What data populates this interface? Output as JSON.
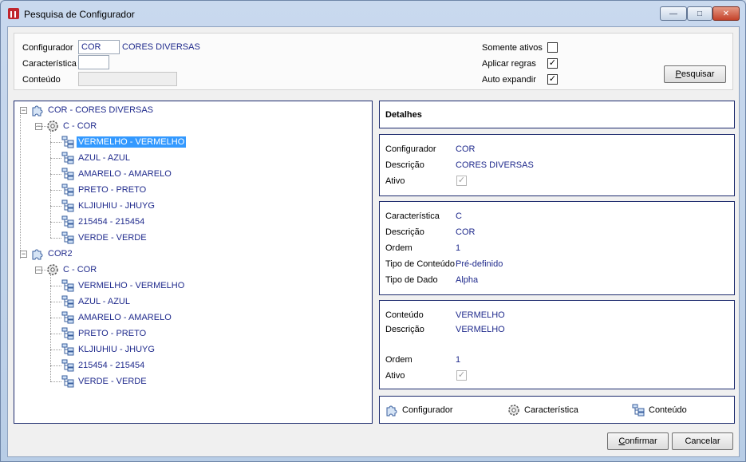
{
  "window": {
    "title": "Pesquisa de Configurador",
    "controls": {
      "minimize": "—",
      "maximize": "□",
      "close": "✕"
    }
  },
  "filters": {
    "configurador_label": "Configurador",
    "configurador_value": "COR",
    "configurador_desc": "CORES DIVERSAS",
    "caracteristica_label": "Característica",
    "caracteristica_value": "",
    "conteudo_label": "Conteúdo",
    "conteudo_value": "",
    "somente_ativos_label": "Somente ativos",
    "somente_ativos_checked": false,
    "aplicar_regras_label": "Aplicar regras",
    "aplicar_regras_checked": true,
    "auto_expandir_label": "Auto expandir",
    "auto_expandir_checked": true,
    "pesquisar_accel": "P",
    "pesquisar_rest": "esquisar"
  },
  "tree": {
    "roots": [
      {
        "label": "COR - CORES DIVERSAS",
        "characteristic": "C - COR",
        "items": [
          "VERMELHO - VERMELHO",
          "AZUL - AZUL",
          "AMARELO - AMARELO",
          "PRETO - PRETO",
          "KLJIUHIU - JHUYG",
          "215454 - 215454",
          "VERDE - VERDE"
        ]
      },
      {
        "label": "COR2",
        "characteristic": "C - COR",
        "items": [
          "VERMELHO - VERMELHO",
          "AZUL - AZUL",
          "AMARELO - AMARELO",
          "PRETO - PRETO",
          "KLJIUHIU - JHUYG",
          "215454 - 215454",
          "VERDE - VERDE"
        ]
      }
    ],
    "selected": "VERMELHO - VERMELHO"
  },
  "details": {
    "header": "Detalhes",
    "configurador": {
      "configurador_label": "Configurador",
      "configurador_value": "COR",
      "descricao_label": "Descrição",
      "descricao_value": "CORES DIVERSAS",
      "ativo_label": "Ativo",
      "ativo_checked": true
    },
    "caracteristica": {
      "caracteristica_label": "Característica",
      "caracteristica_value": "C",
      "descricao_label": "Descrição",
      "descricao_value": "COR",
      "ordem_label": "Ordem",
      "ordem_value": "1",
      "tipo_conteudo_label": "Tipo de Conteúdo",
      "tipo_conteudo_value": "Pré-definido",
      "tipo_dado_label": "Tipo de Dado",
      "tipo_dado_value": "Alpha"
    },
    "conteudo": {
      "conteudo_label": "Conteúdo",
      "conteudo_value": "VERMELHO",
      "descricao_label": "Descrição",
      "descricao_value": "VERMELHO",
      "ordem_label": "Ordem",
      "ordem_value": "1",
      "ativo_label": "Ativo",
      "ativo_checked": true
    }
  },
  "legend": {
    "configurador": "Configurador",
    "caracteristica": "Característica",
    "conteudo": "Conteúdo"
  },
  "footer": {
    "confirmar_accel": "C",
    "confirmar_rest": "onfirmar",
    "cancelar": "Cancelar"
  },
  "colors": {
    "value_text": "#1f2a8c",
    "selection": "#3399ff",
    "panel_border": "#1c2a6d"
  },
  "icons": {
    "configurador": "puzzle-icon",
    "caracteristica": "gear-icon",
    "conteudo": "list-tree-icon"
  }
}
